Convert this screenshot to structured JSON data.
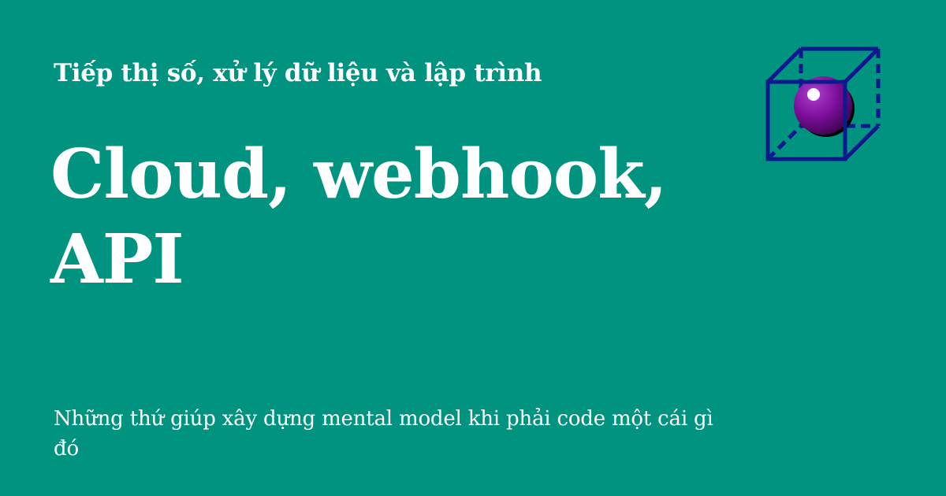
{
  "site": {
    "name": "Tiếp thị số, xử lý dữ liệu và lập trình"
  },
  "page": {
    "title_line1": "Cloud, webhook,",
    "title_line2": "API",
    "subtitle": "Những thứ giúp xây dựng mental model khi phải code một cái gì đó"
  },
  "logo": {
    "icon": "cube-with-sphere-icon",
    "cube_color": "#0d1a8c",
    "sphere_color": "#7a0d99"
  },
  "colors": {
    "background": "#00937f",
    "text": "#ffffff"
  }
}
